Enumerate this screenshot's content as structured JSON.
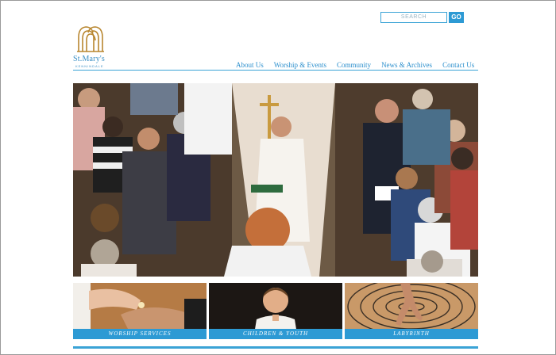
{
  "search": {
    "placeholder": "SEARCH",
    "button_label": "GO"
  },
  "logo": {
    "title": "St.Mary's",
    "subtitle": "KENNINDALE",
    "icon": "church-arches-icon"
  },
  "nav": {
    "items": [
      {
        "label": "About Us"
      },
      {
        "label": "Worship & Events"
      },
      {
        "label": "Community"
      },
      {
        "label": "News & Archives"
      },
      {
        "label": "Contact Us"
      }
    ]
  },
  "hero": {
    "image": "church-procession-photo"
  },
  "tiles": [
    {
      "label": "WORSHIP SERVICES",
      "image": "communion-hands-photo"
    },
    {
      "label": "CHILDREN & YOUTH",
      "image": "child-portrait-photo"
    },
    {
      "label": "LABYRINTH",
      "image": "labyrinth-walk-photo"
    }
  ],
  "colors": {
    "accent": "#2d9ad4",
    "logo_gold": "#b8862f",
    "rule": "#3aa3d6"
  }
}
